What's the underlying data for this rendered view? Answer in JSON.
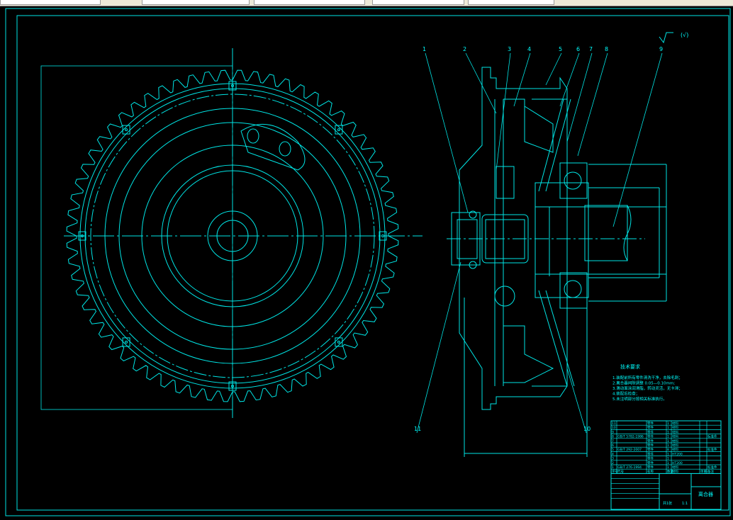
{
  "toolbar": {
    "fields": [
      "",
      "",
      "",
      "",
      ""
    ]
  },
  "colors": {
    "line": "#00e5e5",
    "background": "#000000",
    "toolbar": "#ece9d8"
  },
  "drawing": {
    "roughness_label": "(√)",
    "callouts": [
      "1",
      "2",
      "3",
      "4",
      "5",
      "6",
      "7",
      "8",
      "9",
      "10",
      "11"
    ],
    "notes_title": "技术要求",
    "notes": [
      "1.装配前所有零件清洗干净，去除毛刺；",
      "2.离合器间隙调整 0.05—0.10mm;",
      "3.滑动面涂润滑脂，转动灵活，无卡滞；",
      "4.装配后检查；",
      "5.未注明部分按相关标准执行。"
    ],
    "parts_table": {
      "rows": [
        [
          "11",
          "",
          "零件",
          "1",
          "材料",
          "",
          ""
        ],
        [
          "10",
          "",
          "零件",
          "1",
          "材料",
          "",
          ""
        ],
        [
          "9",
          "",
          "零件",
          "1",
          "材料",
          "",
          ""
        ],
        [
          "8",
          "GB/T 5782-1986",
          "零件",
          "1",
          "材料",
          "",
          "标准件"
        ],
        [
          "7",
          "",
          "零件",
          "1",
          "材料",
          "",
          ""
        ],
        [
          "6",
          "",
          "零件",
          "1",
          "材料",
          "",
          ""
        ],
        [
          "5",
          "GB/T 292-2007",
          "零件",
          "8",
          "材料",
          "",
          "标准件"
        ],
        [
          "4",
          "",
          "零件",
          "1",
          "HT200",
          "",
          ""
        ],
        [
          "3",
          "",
          "零件",
          "1",
          "",
          "",
          " "
        ],
        [
          "2",
          "",
          "零件",
          "1",
          "HT200",
          "",
          ""
        ],
        [
          "1",
          "GB/T 276-1994",
          "零件",
          "1",
          "材料",
          "",
          "标准件"
        ]
      ],
      "header": [
        "序号",
        "代号",
        "名称",
        "数量",
        "材料",
        "单重",
        "备注"
      ]
    },
    "title_block": {
      "title": "离合器",
      "scale": "1:1",
      "sheet": "共1张"
    }
  }
}
